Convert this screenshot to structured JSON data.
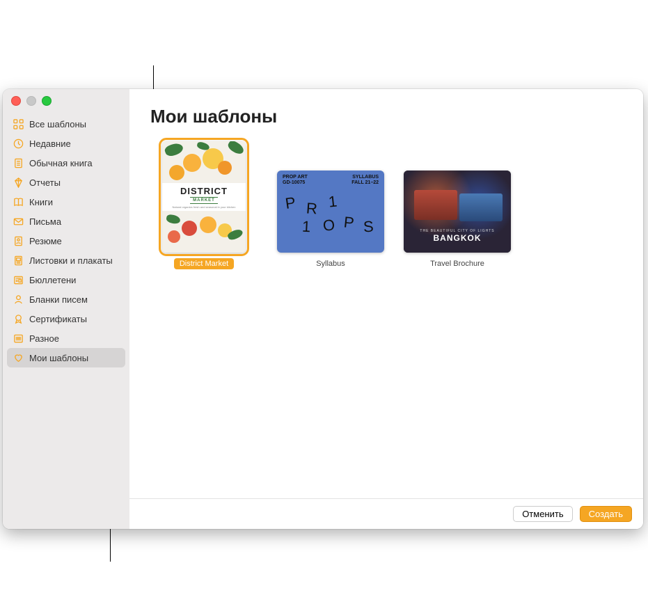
{
  "sidebar": {
    "items": [
      {
        "label": "Все шаблоны",
        "icon": "grid"
      },
      {
        "label": "Недавние",
        "icon": "clock"
      },
      {
        "label": "Обычная книга",
        "icon": "doc"
      },
      {
        "label": "Отчеты",
        "icon": "crystal"
      },
      {
        "label": "Книги",
        "icon": "book"
      },
      {
        "label": "Письма",
        "icon": "envelope"
      },
      {
        "label": "Резюме",
        "icon": "person-doc"
      },
      {
        "label": "Листовки и плакаты",
        "icon": "poster"
      },
      {
        "label": "Бюллетени",
        "icon": "news"
      },
      {
        "label": "Бланки писем",
        "icon": "person-card"
      },
      {
        "label": "Сертификаты",
        "icon": "ribbon"
      },
      {
        "label": "Разное",
        "icon": "list"
      },
      {
        "label": "Мои шаблоны",
        "icon": "heart",
        "selected": true
      }
    ]
  },
  "header": {
    "title": "Мои шаблоны"
  },
  "templates": [
    {
      "name": "District Market",
      "orientation": "portrait",
      "selected": true,
      "art": {
        "title": "DISTRICT",
        "subtitle": "MARKET",
        "tagline": "Natural organics fresh and seasonal in your kitchen"
      }
    },
    {
      "name": "Syllabus",
      "orientation": "landscape",
      "selected": false,
      "art": {
        "topLeft1": "PROP ART",
        "topLeft2": "GD-10075",
        "topRight1": "SYLLABUS",
        "topRight2": "FALL 21–22",
        "letters": "PROPS",
        "digits": "11"
      }
    },
    {
      "name": "Travel Brochure",
      "orientation": "landscape",
      "selected": false,
      "art": {
        "line1": "THE BEAUTIFUL CITY OF LIGHTS",
        "line2": "BANGKOK"
      }
    }
  ],
  "footer": {
    "cancel": "Отменить",
    "create": "Создать"
  }
}
